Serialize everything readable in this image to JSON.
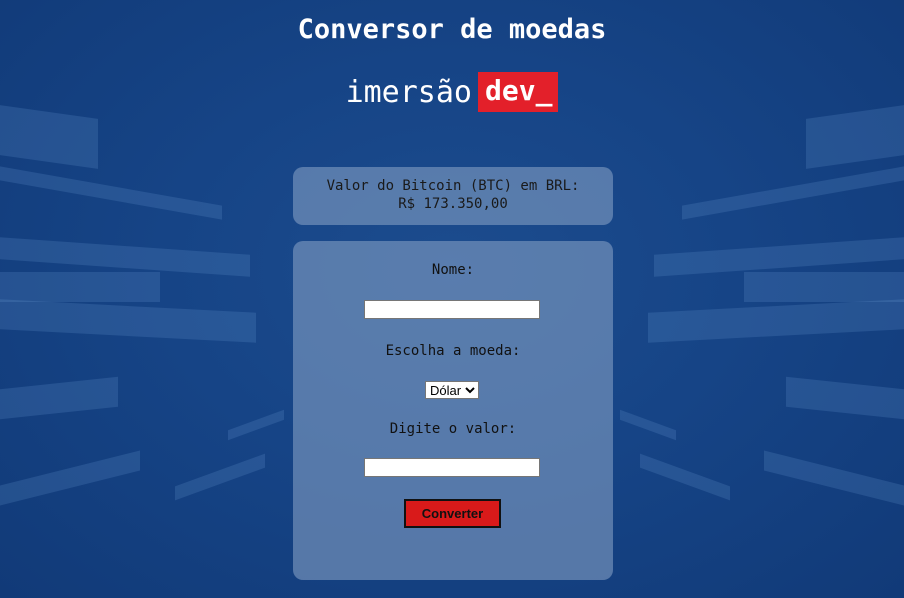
{
  "page": {
    "title": "Conversor de moedas"
  },
  "logo": {
    "text": "imersão",
    "badge": "dev_"
  },
  "btc": {
    "label": "Valor do Bitcoin (BTC) em BRL:",
    "value": "R$ 173.350,00"
  },
  "form": {
    "name_label": "Nome:",
    "name_value": "",
    "currency_label": "Escolha a moeda:",
    "currency_selected": "Dólar",
    "amount_label": "Digite o valor:",
    "amount_value": "",
    "convert_label": "Converter"
  },
  "colors": {
    "background": "#154384",
    "panel": "#8ca5c8",
    "accent": "#e3202a",
    "button": "#d91a1a"
  }
}
